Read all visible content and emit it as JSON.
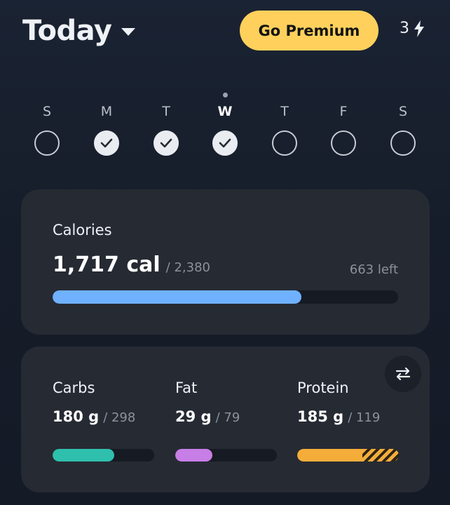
{
  "header": {
    "title": "Today",
    "premium_label": "Go Premium",
    "energy_count": "3"
  },
  "week": {
    "days": [
      {
        "letter": "S",
        "done": false,
        "current": false
      },
      {
        "letter": "M",
        "done": true,
        "current": false
      },
      {
        "letter": "T",
        "done": true,
        "current": false
      },
      {
        "letter": "W",
        "done": true,
        "current": true
      },
      {
        "letter": "T",
        "done": false,
        "current": false
      },
      {
        "letter": "F",
        "done": false,
        "current": false
      },
      {
        "letter": "S",
        "done": false,
        "current": false
      }
    ]
  },
  "calories": {
    "label": "Calories",
    "value": "1,717 cal",
    "goal": "/ 2,380",
    "remaining": "663 left",
    "progress_fraction": 0.721
  },
  "macros": [
    {
      "name": "Carbs",
      "value": "180 g",
      "goal": "/ 298",
      "progress_fraction": 0.604,
      "over_fraction": 0,
      "color": "#2ebfad"
    },
    {
      "name": "Fat",
      "value": "29 g",
      "goal": "/ 79",
      "progress_fraction": 0.367,
      "over_fraction": 0,
      "color": "#c77ee6"
    },
    {
      "name": "Protein",
      "value": "185 g",
      "goal": "/ 119",
      "progress_fraction": 0.643,
      "over_fraction": 0.357,
      "color": "#f5ad3a"
    }
  ],
  "icons": {
    "header_caret": "caret-down-icon",
    "energy": "lightning-bolt-icon",
    "day_done": "checkmark-icon",
    "macro_toggle": "swap-arrows-icon"
  },
  "colors": {
    "accent_premium": "#ffd15c",
    "calories_bar": "#6fb1ff",
    "card_background": "#262a33"
  }
}
